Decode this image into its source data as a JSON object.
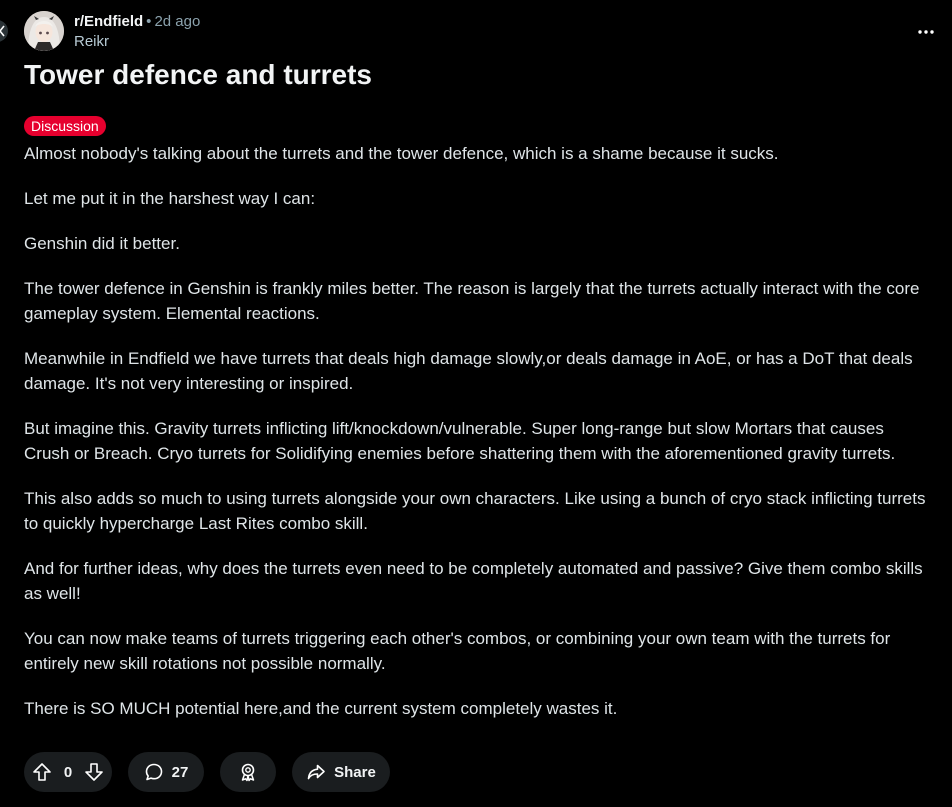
{
  "post": {
    "subreddit": "r/Endfield",
    "separator": "•",
    "time": "2d ago",
    "author": "Reikr",
    "title": "Tower defence and turrets",
    "flair": "Discussion",
    "paragraphs": [
      "Almost nobody's talking about the turrets and the tower defence, which is a shame because it sucks.",
      "Let me put it in the harshest way I can:",
      "Genshin did it better.",
      "The tower defence in Genshin is frankly miles better. The reason is largely that the turrets actually interact with the core gameplay system. Elemental reactions.",
      "Meanwhile in Endfield we have turrets that deals high damage slowly,or deals damage in AoE, or has a DoT that deals damage. It's not very interesting or inspired.",
      "But imagine this. Gravity turrets inflicting lift/knockdown/vulnerable. Super long-range but slow Mortars that causes Crush or Breach. Cryo turrets for Solidifying enemies before shattering them with the aforementioned gravity turrets.",
      "This also adds so much to using turrets alongside your own characters. Like using a bunch of cryo stack inflicting turrets to quickly hypercharge Last Rites combo skill.",
      "And for further ideas, why does the turrets even need to be completely automated and passive? Give them combo skills as well!",
      "You can now make teams of turrets triggering each other's combos, or combining your own team with the turrets for entirely new skill rotations not possible normally.",
      "There is SO MUCH potential here,and the current system completely wastes it."
    ]
  },
  "actions": {
    "vote_count": "0",
    "comment_count": "27",
    "share_label": "Share"
  },
  "icons": {
    "back": "chevron-left-icon",
    "more": "more-horizontal-icon",
    "upvote": "upvote-arrow-icon",
    "downvote": "downvote-arrow-icon",
    "comment": "comment-bubble-icon",
    "award": "award-icon",
    "share": "share-arrow-icon"
  },
  "colors": {
    "background": "#000000",
    "flair": "#e6002e",
    "meta_muted": "#8ba2ad",
    "button_bg": "#1a1d1f"
  }
}
